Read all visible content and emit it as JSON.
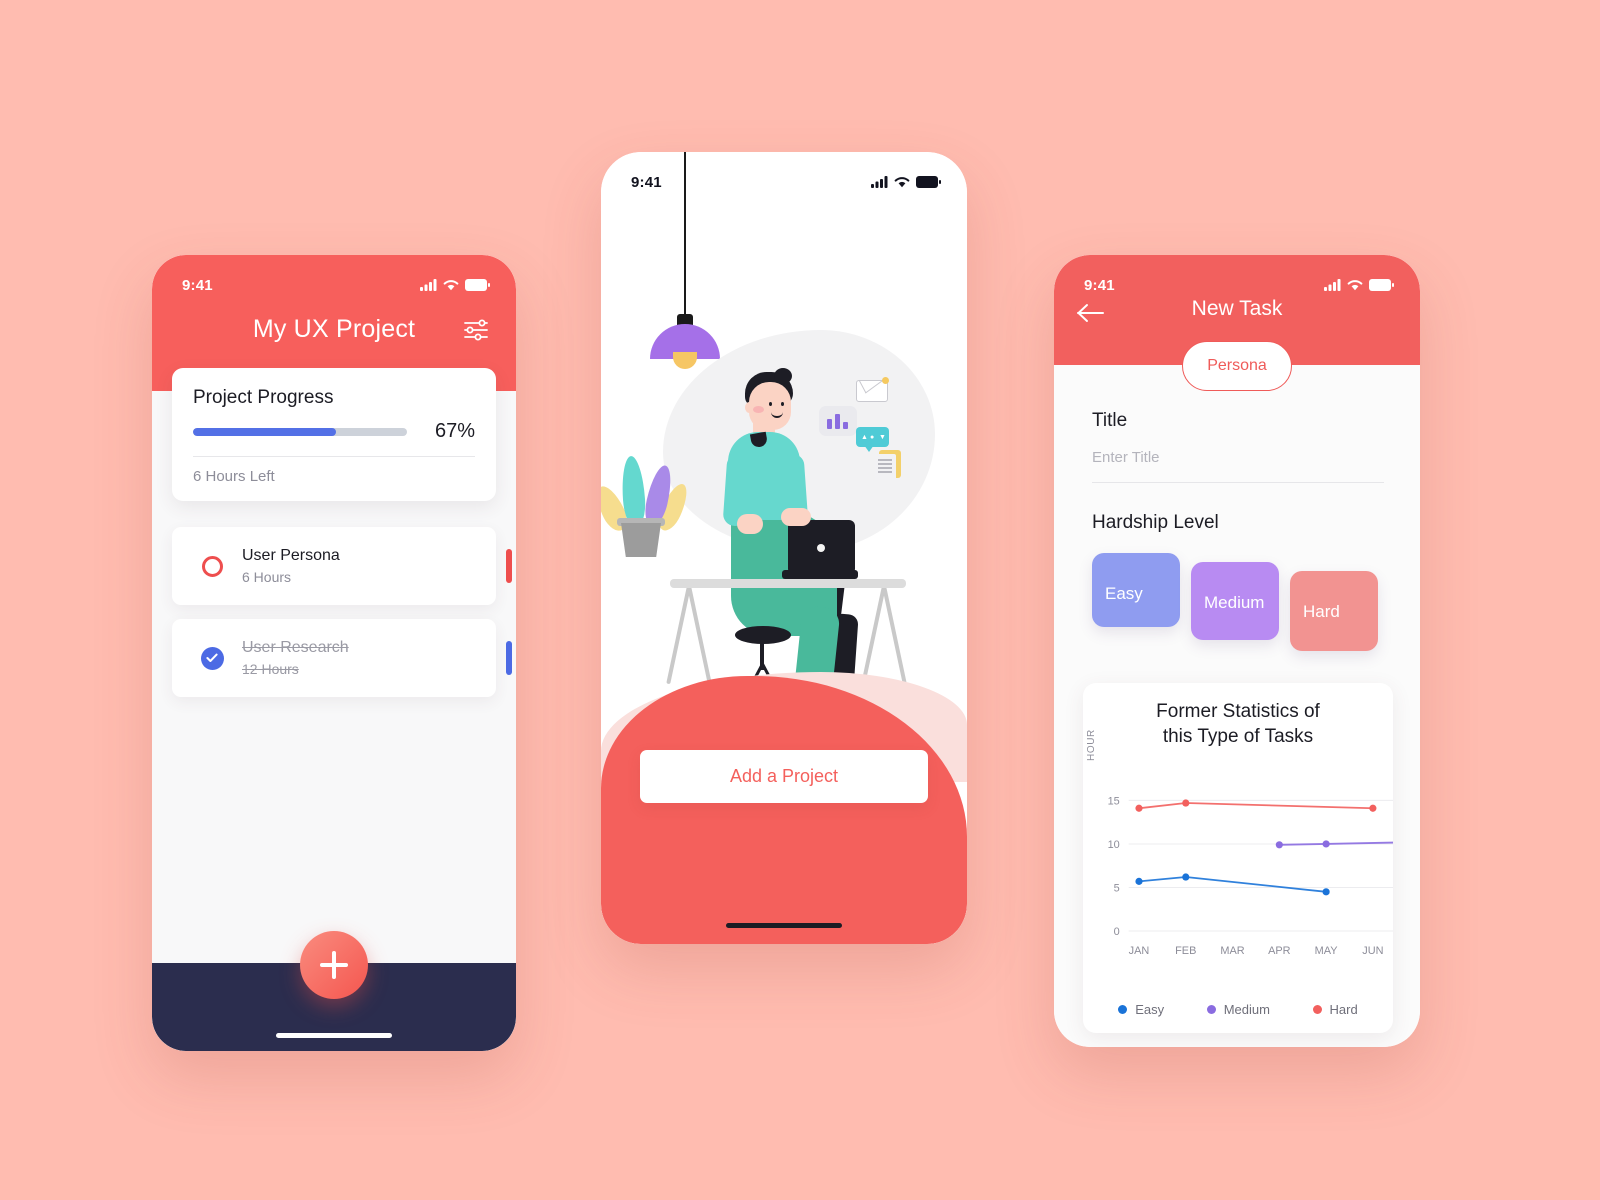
{
  "theme": {
    "page_background": "#ffbcb0",
    "brand_red": "#f4605c",
    "header_red_1": "#f75f5c",
    "header_red_3": "#f2605e",
    "navy": "#2b2d4e",
    "progress_blue": "#5370e6",
    "easy_color": "#8f9cf0",
    "medium_color": "#b88bf2",
    "hard_color": "#f29391"
  },
  "phone1": {
    "status": {
      "time": "9:41",
      "signal_icon": "cellular-signal-icon",
      "wifi_icon": "wifi-icon",
      "battery_icon": "battery-icon"
    },
    "header": {
      "title": "My UX Project",
      "filter_icon": "sliders-filter-icon"
    },
    "progress_card": {
      "title": "Project Progress",
      "percent_label": "67%",
      "percent_value": 67,
      "subtitle": "6 Hours Left"
    },
    "tasks": [
      {
        "name": "User Persona",
        "hours": "6 Hours",
        "done": false,
        "accent": "#ee4e4e",
        "status_icon": "circle-outline-icon"
      },
      {
        "name": "User Research",
        "hours": "12 Hours",
        "done": true,
        "accent": "#4c6ae4",
        "status_icon": "check-circle-icon"
      }
    ],
    "fab": {
      "icon": "plus-icon",
      "label": "Add task"
    }
  },
  "phone2": {
    "status": {
      "time": "9:41",
      "signal_icon": "cellular-signal-icon",
      "wifi_icon": "wifi-icon",
      "battery_icon": "battery-icon"
    },
    "illustration": {
      "name": "person-working-at-desk-illustration",
      "elements": [
        "pendant-lamp-icon",
        "potted-plant-icon",
        "desk-icon",
        "laptop-icon",
        "chair-icon",
        "bar-chart-float-icon",
        "envelope-float-icon",
        "chat-bubble-float-icon",
        "document-float-icon"
      ],
      "bubble_glyphs": "▲ ● ▼"
    },
    "cta": {
      "label": "Add a Project"
    }
  },
  "phone3": {
    "status": {
      "time": "9:41",
      "signal_icon": "cellular-signal-icon",
      "wifi_icon": "wifi-icon",
      "battery_icon": "battery-icon"
    },
    "header": {
      "title": "New Task",
      "back_icon": "arrow-left-icon"
    },
    "pill": {
      "label": "Persona"
    },
    "form": {
      "title_label": "Title",
      "title_value": "",
      "title_placeholder": "Enter Title",
      "hardship_label": "Hardship Level",
      "hardship_options": [
        {
          "label": "Easy",
          "color": "#8f9cf0"
        },
        {
          "label": "Medium",
          "color": "#b88bf2"
        },
        {
          "label": "Hard",
          "color": "#f29391"
        }
      ]
    }
  },
  "chart_data": {
    "type": "line",
    "title": "Former Statistics of this Type of Tasks",
    "title_line1": "Former Statistics of",
    "title_line2": "this Type of Tasks",
    "xlabel": "",
    "ylabel": "HOUR",
    "categories": [
      "JAN",
      "FEB",
      "MAR",
      "APR",
      "MAY",
      "JUN"
    ],
    "yticks": [
      0,
      5,
      10,
      15
    ],
    "ylim": [
      0,
      17
    ],
    "grid": true,
    "legend_position": "bottom",
    "series": [
      {
        "name": "Easy",
        "color": "#1a73d8",
        "points": [
          {
            "x": "JAN",
            "y": 5.7
          },
          {
            "x": "FEB",
            "y": 6.2
          },
          {
            "x": "MAY",
            "y": 4.5
          }
        ]
      },
      {
        "name": "Medium",
        "color": "#8a6ce0",
        "points": [
          {
            "x": "APR",
            "y": 9.9
          },
          {
            "x": "MAY",
            "y": 10.0
          },
          {
            "x": "JUN+",
            "y": 10.2
          }
        ]
      },
      {
        "name": "Hard",
        "color": "#f2605e",
        "points": [
          {
            "x": "JAN",
            "y": 14.1
          },
          {
            "x": "FEB",
            "y": 14.7
          },
          {
            "x": "JUN",
            "y": 14.1
          }
        ]
      }
    ]
  }
}
